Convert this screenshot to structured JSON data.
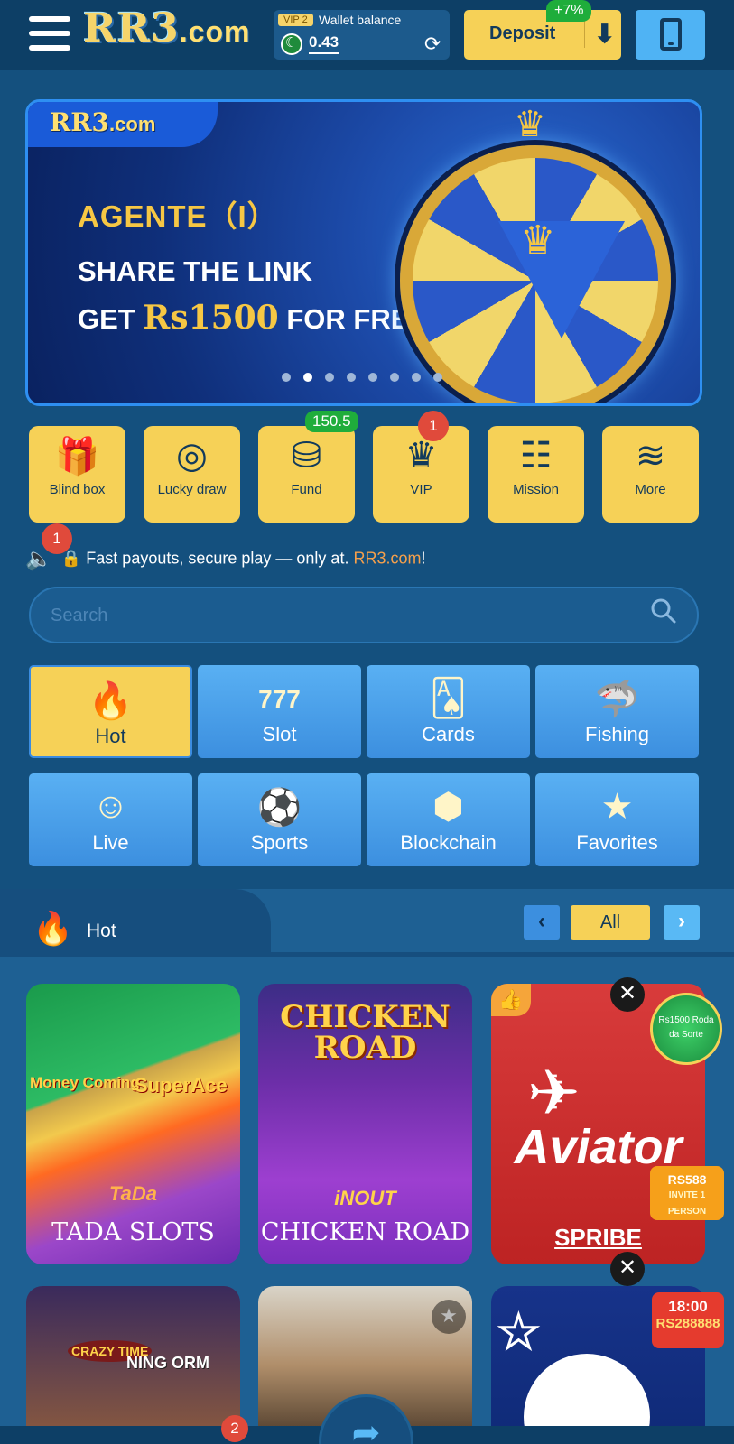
{
  "header": {
    "logo": "RR3",
    "logo_suffix": ".com",
    "vip_level": "VIP 2",
    "wallet_label": "Wallet balance",
    "wallet_amount": "0.43",
    "deposit_label": "Deposit",
    "deposit_bonus": "+7%"
  },
  "banner": {
    "logo": "RR3",
    "logo_suffix": ".com",
    "title": "AGENTE（I）",
    "line1": "SHARE THE LINK",
    "line2_prefix": "GET ",
    "line2_amount": "Rs1500",
    "line2_suffix": " FOR FREE",
    "slide_count": 8,
    "active_slide": 2
  },
  "quick_actions": [
    {
      "label": "Blind box",
      "icon": "gift-box-icon"
    },
    {
      "label": "Lucky draw",
      "icon": "spin-wheel-icon"
    },
    {
      "label": "Fund",
      "icon": "fund-hand-icon",
      "badge": "150.5"
    },
    {
      "label": "VIP",
      "icon": "vip-crown-icon",
      "badge": "1"
    },
    {
      "label": "Mission",
      "icon": "mission-checklist-icon"
    },
    {
      "label": "More",
      "icon": "layers-icon"
    }
  ],
  "notice": {
    "badge": "1",
    "text": "🔒 Fast payouts, secure play — only at. ",
    "brand": "RR3.com",
    "end": "!"
  },
  "search": {
    "placeholder": "Search"
  },
  "categories": [
    {
      "label": "Hot",
      "icon": "fire-icon",
      "active": true
    },
    {
      "label": "Slot",
      "icon": "slot-777-icon"
    },
    {
      "label": "Cards",
      "icon": "cards-icon"
    },
    {
      "label": "Fishing",
      "icon": "shark-icon"
    },
    {
      "label": "Live",
      "icon": "live-dealer-icon"
    },
    {
      "label": "Sports",
      "icon": "soccer-ball-icon"
    },
    {
      "label": "Blockchain",
      "icon": "blockchain-icon"
    },
    {
      "label": "Favorites",
      "icon": "star-icon"
    }
  ],
  "hot_section": {
    "title": "Hot",
    "all_label": "All",
    "prev": "‹",
    "next": "›"
  },
  "games": [
    {
      "name": "TADA SLOTS",
      "tiles": [
        "Money Coming",
        "SuperAce"
      ],
      "brand": "TaDa"
    },
    {
      "name": "CHICKEN ROAD",
      "title_art": "CHICKEN ROAD",
      "brand": "iNOUT"
    },
    {
      "name": "SPRIBE",
      "title_art": "Aviator"
    },
    {
      "name": "",
      "tiles": [
        "CRAZY TIME",
        "NING ORM"
      ]
    },
    {
      "name": ""
    },
    {
      "name": ""
    }
  ],
  "floating": {
    "wheel_text": "Rs1500 Roda da Sorte",
    "invite_amount": "RS588",
    "invite_text": "INVITE 1 PERSON",
    "timer": "18:00",
    "timer_amount": "RS288888"
  },
  "bottom_nav": {
    "badge": "2"
  },
  "colors": {
    "background": "#14507e",
    "accent_yellow": "#f6d157",
    "accent_blue": "#59b0f3",
    "badge_green": "#1fad3b",
    "badge_red": "#e04a3b"
  }
}
